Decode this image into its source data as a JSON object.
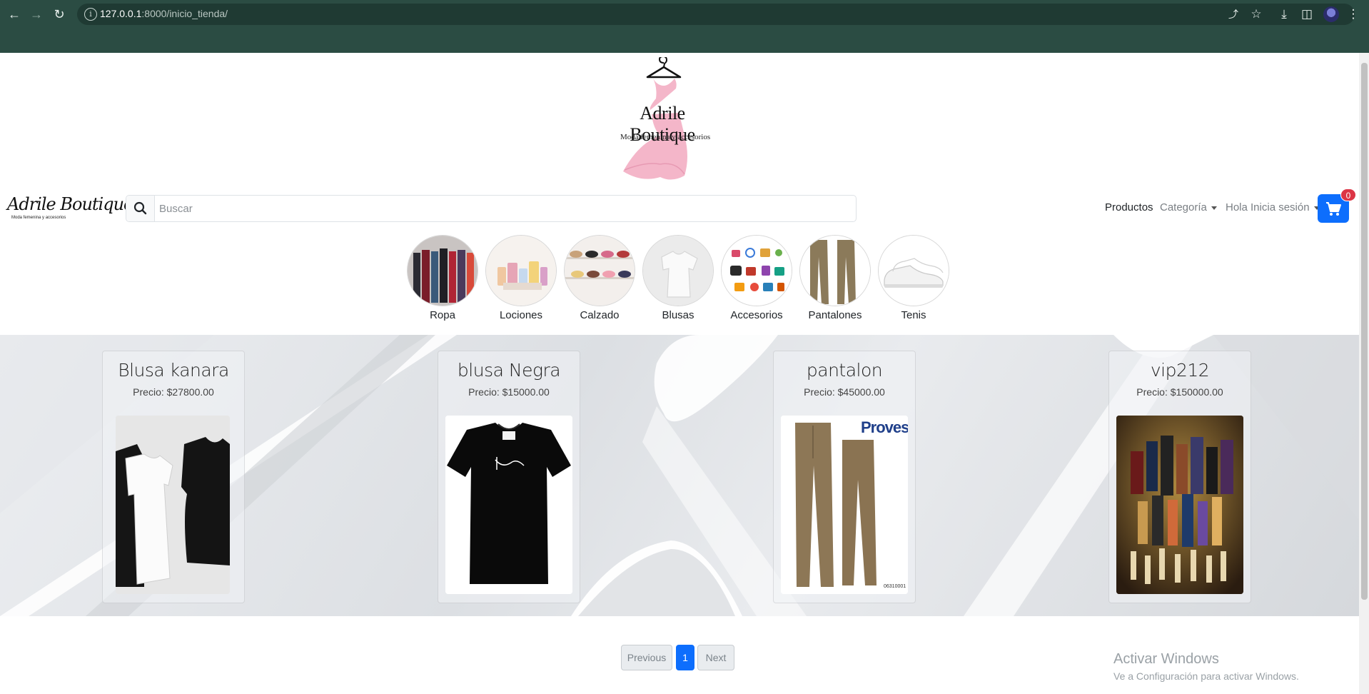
{
  "browser": {
    "url_host": "127.0.0.1",
    "url_rest": ":8000/inicio_tienda/",
    "back_icon": "arrow-left-icon",
    "forward_icon": "arrow-right-icon",
    "reload_icon": "reload-icon",
    "info_icon": "info-icon",
    "share_icon": "share-icon",
    "star_icon": "star-icon",
    "download_icon": "download-icon",
    "sidepanel_icon": "side-panel-icon",
    "menu_icon": "kebab-menu-icon"
  },
  "hero": {
    "name": "Adrile Boutique",
    "tagline": "Moda femenina y accesorios"
  },
  "navbar": {
    "brand_name": "Adrile Boutique",
    "brand_tagline": "Moda femenina y accesorios",
    "search_placeholder": "Buscar",
    "links": {
      "productos": "Productos",
      "categoria": "Categoría",
      "login": "Hola Inicia sesión"
    },
    "cart_count": "0"
  },
  "categories": [
    {
      "label": "Ropa"
    },
    {
      "label": "Lociones"
    },
    {
      "label": "Calzado"
    },
    {
      "label": "Blusas"
    },
    {
      "label": "Accesorios"
    },
    {
      "label": "Pantalones"
    },
    {
      "label": "Tenis"
    }
  ],
  "products": [
    {
      "title": "Blusa kanara",
      "price_label": "Precio:",
      "price": "$27800.00"
    },
    {
      "title": "blusa Negra",
      "price_label": "Precio:",
      "price": "$15000.00"
    },
    {
      "title": "pantalon",
      "price_label": "Precio:",
      "price": "$45000.00",
      "image_text": "Provesi",
      "image_code": "06310001"
    },
    {
      "title": "vip212",
      "price_label": "Precio:",
      "price": "$150000.00"
    }
  ],
  "pagination": {
    "previous": "Previous",
    "current": "1",
    "next": "Next"
  },
  "watermark": {
    "title": "Activar Windows",
    "subtitle": "Ve a Configuración para activar Windows."
  },
  "colors": {
    "chrome": "#2b4c43",
    "primary": "#0d6efd",
    "badge": "#dc3545",
    "logo_pink": "#f4b6c9"
  }
}
